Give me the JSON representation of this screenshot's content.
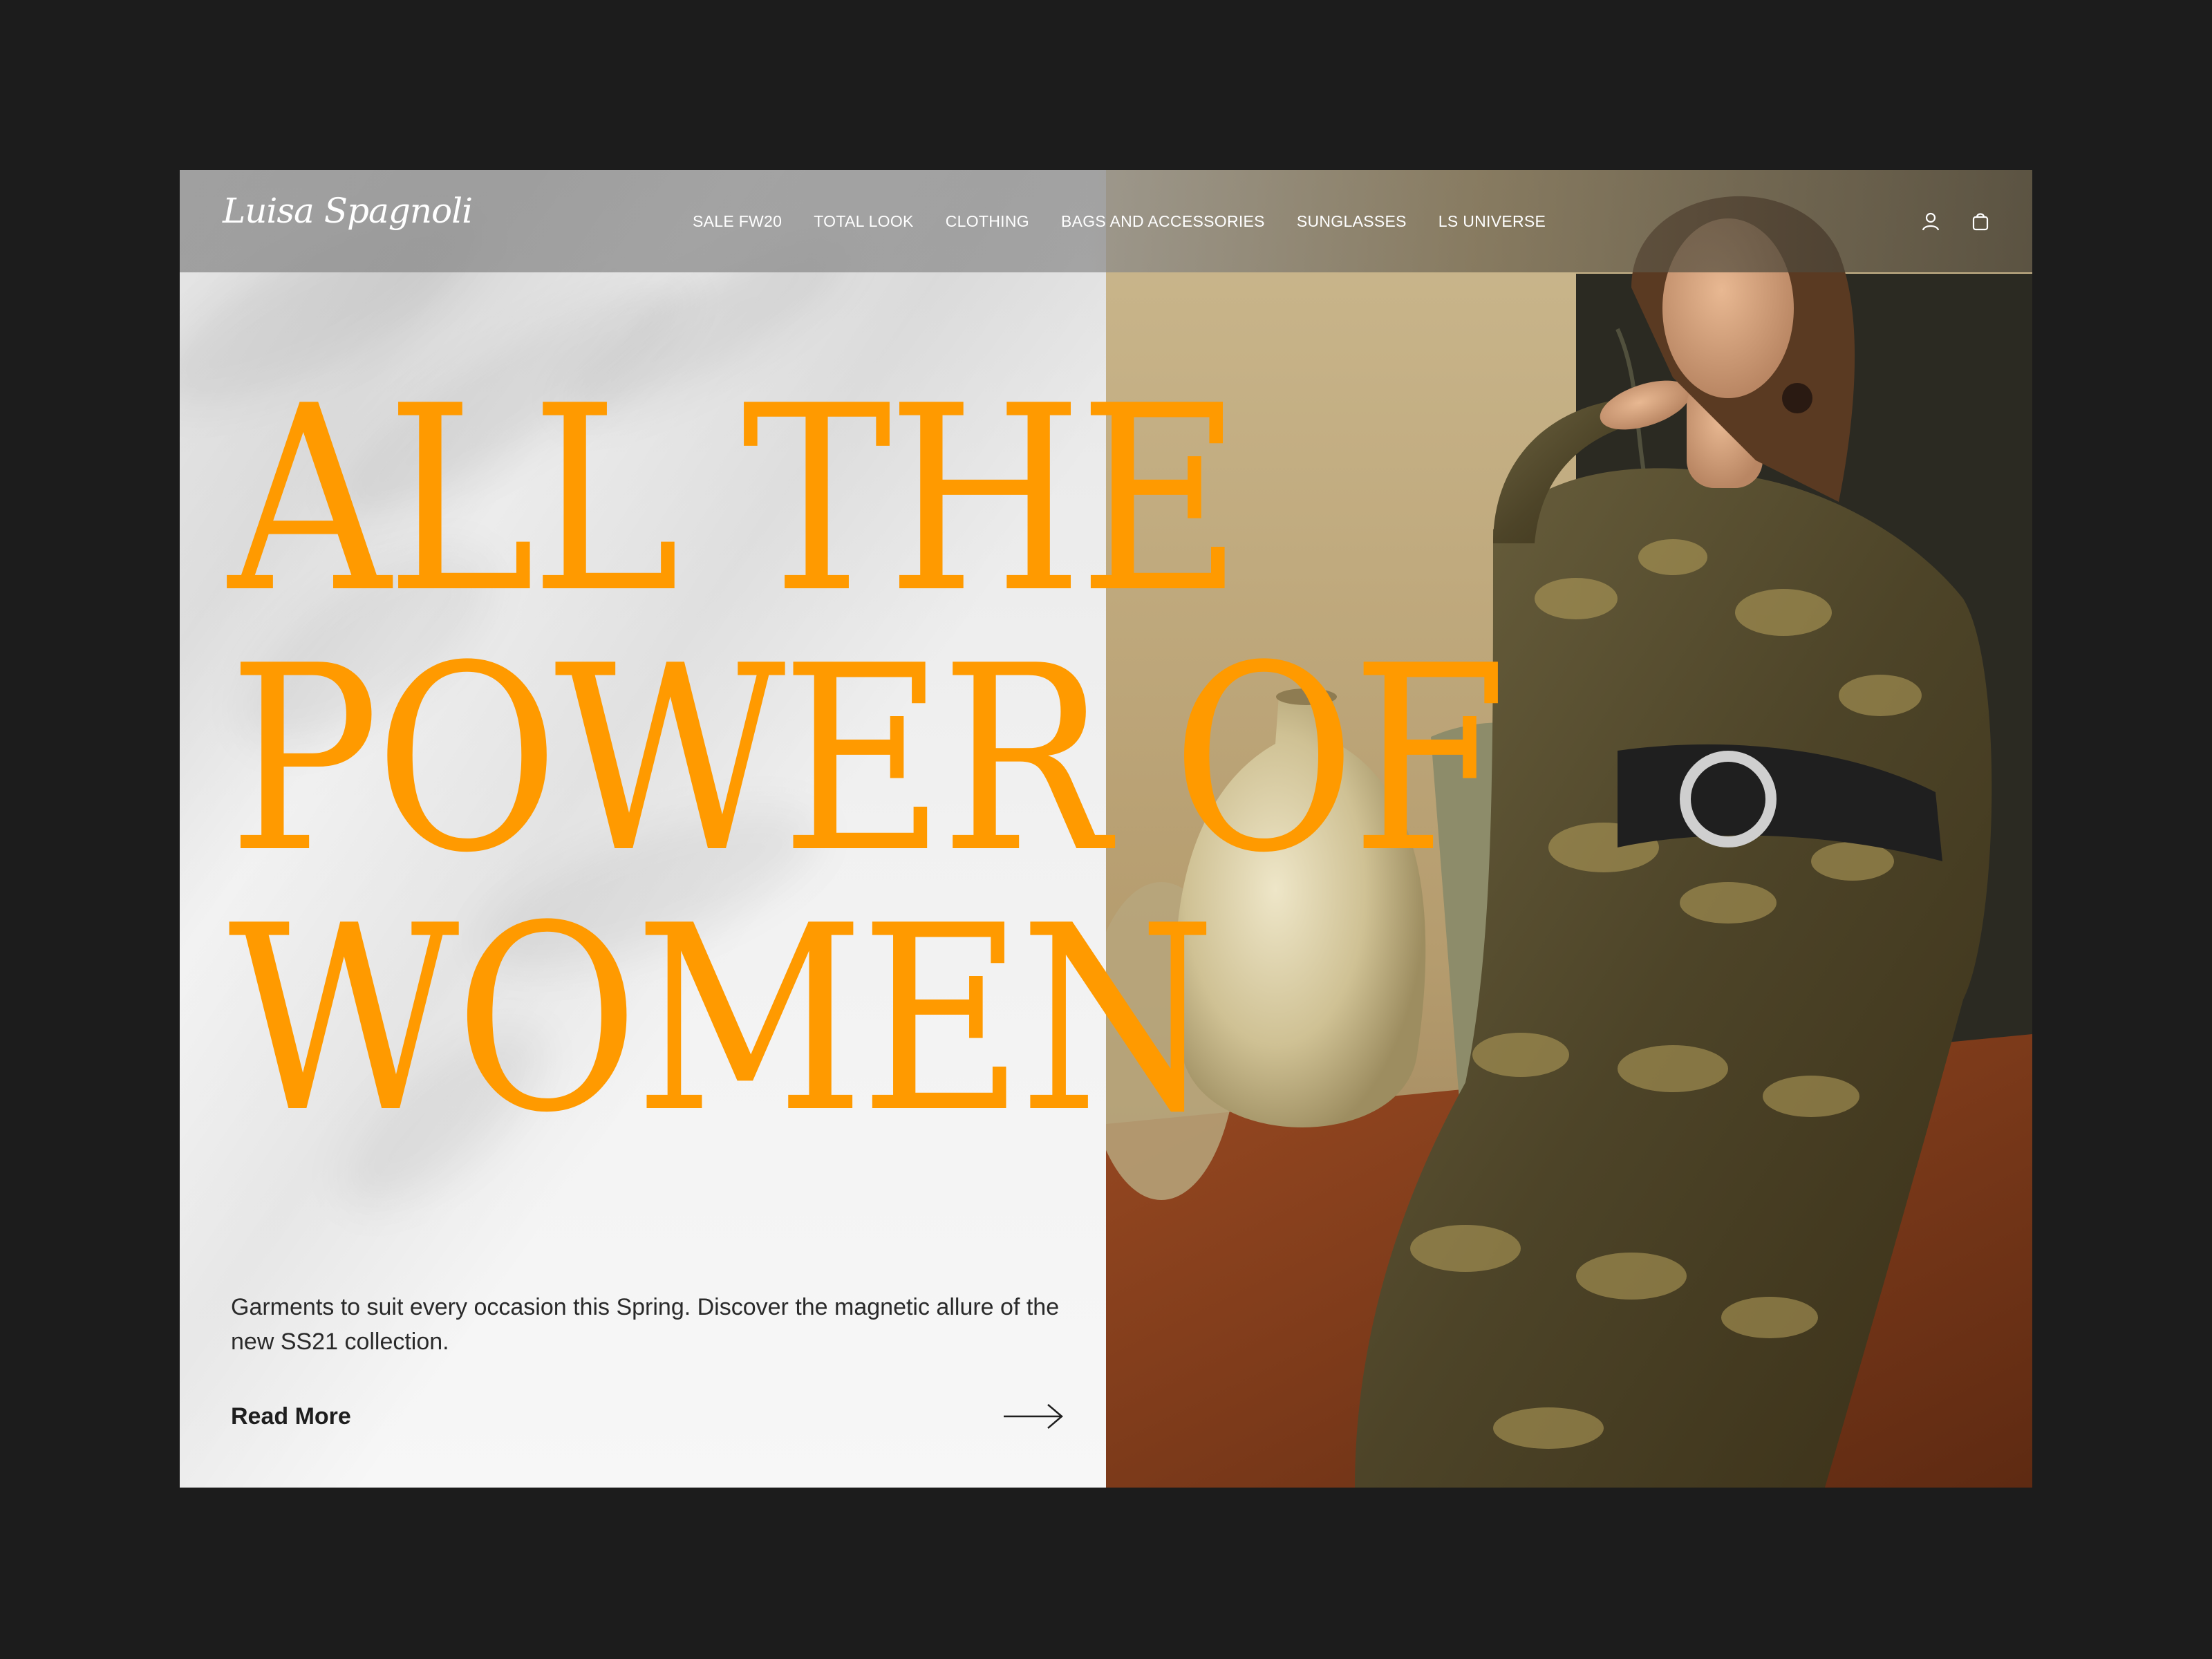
{
  "brand": {
    "logo_text": "Luisa Spagnoli"
  },
  "nav": {
    "items": [
      {
        "label": "SALE FW20"
      },
      {
        "label": "TOTAL LOOK"
      },
      {
        "label": "CLOTHING"
      },
      {
        "label": "BAGS AND ACCESSORIES"
      },
      {
        "label": "SUNGLASSES"
      },
      {
        "label": "LS UNIVERSE"
      }
    ],
    "icons": [
      "user-icon",
      "shopping-bag-icon"
    ]
  },
  "hero": {
    "headline": [
      "ALL THE",
      "POWER OF",
      "WOMEN"
    ],
    "description": "Garments to suit every occasion this Spring. Discover the magnetic allure of the new SS21 collection.",
    "cta_label": "Read More",
    "cta_icon": "arrow-right-icon"
  },
  "colors": {
    "accent": "#ff9a00",
    "page_background": "#1c1c1c",
    "panel_background": "#f3f3f3",
    "text": "#2a2a2a"
  }
}
